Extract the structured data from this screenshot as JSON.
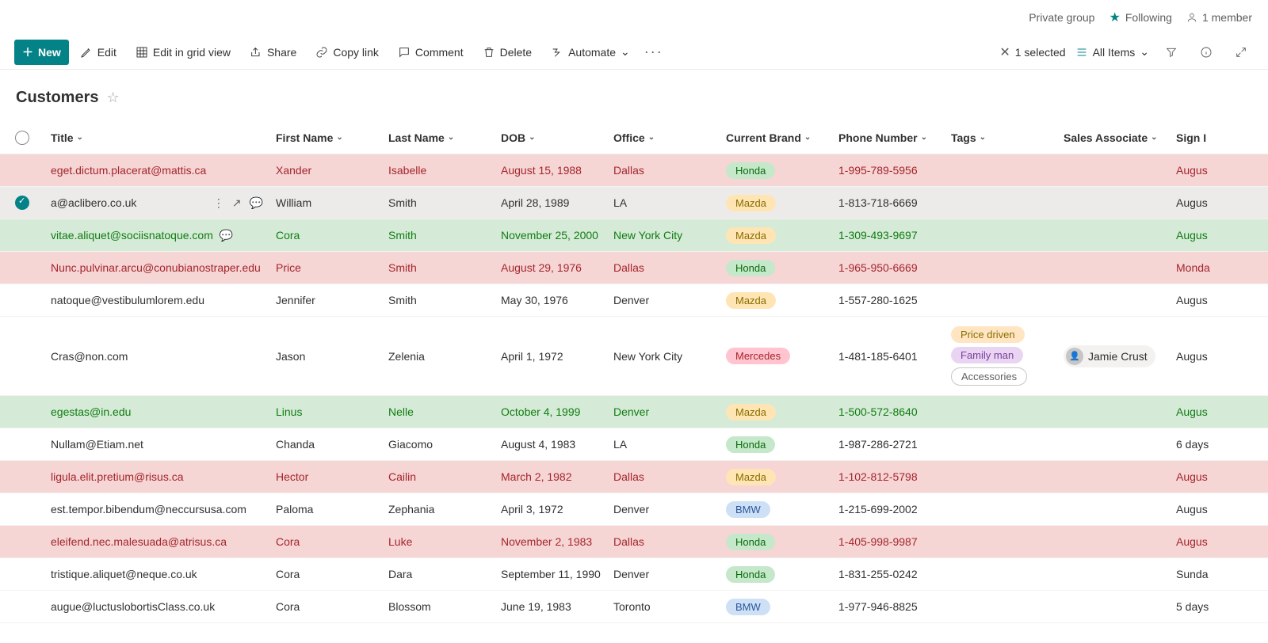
{
  "topbar": {
    "group_type": "Private group",
    "following": "Following",
    "members": "1 member"
  },
  "commands": {
    "new": "New",
    "edit": "Edit",
    "grid": "Edit in grid view",
    "share": "Share",
    "copy": "Copy link",
    "comment": "Comment",
    "delete": "Delete",
    "automate": "Automate",
    "selected": "1 selected",
    "view": "All Items"
  },
  "list": {
    "title": "Customers"
  },
  "columns": {
    "title": "Title",
    "first_name": "First Name",
    "last_name": "Last Name",
    "dob": "DOB",
    "office": "Office",
    "current_brand": "Current Brand",
    "phone": "Phone Number",
    "tags": "Tags",
    "sales_associate": "Sales Associate",
    "sign": "Sign I"
  },
  "rows": [
    {
      "style": "pink",
      "title": "eget.dictum.placerat@mattis.ca",
      "first": "Xander",
      "last": "Isabelle",
      "dob": "August 15, 1988",
      "office": "Dallas",
      "brand": "Honda",
      "phone": "1-995-789-5956",
      "sign": "Augus"
    },
    {
      "style": "selected",
      "title": "a@aclibero.co.uk",
      "first": "William",
      "last": "Smith",
      "dob": "April 28, 1989",
      "office": "LA",
      "brand": "Mazda",
      "phone": "1-813-718-6669",
      "sign": "Augus",
      "selected": true,
      "actions": true
    },
    {
      "style": "green",
      "title": "vitae.aliquet@sociisnatoque.com",
      "first": "Cora",
      "last": "Smith",
      "dob": "November 25, 2000",
      "office": "New York City",
      "brand": "Mazda",
      "phone": "1-309-493-9697",
      "sign": "Augus",
      "comment": true
    },
    {
      "style": "pink",
      "title": "Nunc.pulvinar.arcu@conubianostraper.edu",
      "first": "Price",
      "last": "Smith",
      "dob": "August 29, 1976",
      "office": "Dallas",
      "brand": "Honda",
      "phone": "1-965-950-6669",
      "sign": "Monda"
    },
    {
      "style": "",
      "title": "natoque@vestibulumlorem.edu",
      "first": "Jennifer",
      "last": "Smith",
      "dob": "May 30, 1976",
      "office": "Denver",
      "brand": "Mazda",
      "phone": "1-557-280-1625",
      "sign": "Augus"
    },
    {
      "style": "",
      "tall": true,
      "title": "Cras@non.com",
      "first": "Jason",
      "last": "Zelenia",
      "dob": "April 1, 1972",
      "office": "New York City",
      "brand": "Mercedes",
      "phone": "1-481-185-6401",
      "tags": [
        "Price driven",
        "Family man",
        "Accessories"
      ],
      "assoc": "Jamie Crust",
      "sign": "Augus"
    },
    {
      "style": "green",
      "title": "egestas@in.edu",
      "first": "Linus",
      "last": "Nelle",
      "dob": "October 4, 1999",
      "office": "Denver",
      "brand": "Mazda",
      "phone": "1-500-572-8640",
      "sign": "Augus"
    },
    {
      "style": "",
      "title": "Nullam@Etiam.net",
      "first": "Chanda",
      "last": "Giacomo",
      "dob": "August 4, 1983",
      "office": "LA",
      "brand": "Honda",
      "phone": "1-987-286-2721",
      "sign": "6 days"
    },
    {
      "style": "pink",
      "title": "ligula.elit.pretium@risus.ca",
      "first": "Hector",
      "last": "Cailin",
      "dob": "March 2, 1982",
      "office": "Dallas",
      "brand": "Mazda",
      "phone": "1-102-812-5798",
      "sign": "Augus"
    },
    {
      "style": "",
      "title": "est.tempor.bibendum@neccursusa.com",
      "first": "Paloma",
      "last": "Zephania",
      "dob": "April 3, 1972",
      "office": "Denver",
      "brand": "BMW",
      "phone": "1-215-699-2002",
      "sign": "Augus"
    },
    {
      "style": "pink",
      "title": "eleifend.nec.malesuada@atrisus.ca",
      "first": "Cora",
      "last": "Luke",
      "dob": "November 2, 1983",
      "office": "Dallas",
      "brand": "Honda",
      "phone": "1-405-998-9987",
      "sign": "Augus"
    },
    {
      "style": "",
      "title": "tristique.aliquet@neque.co.uk",
      "first": "Cora",
      "last": "Dara",
      "dob": "September 11, 1990",
      "office": "Denver",
      "brand": "Honda",
      "phone": "1-831-255-0242",
      "sign": "Sunda"
    },
    {
      "style": "",
      "title": "augue@luctuslobortisClass.co.uk",
      "first": "Cora",
      "last": "Blossom",
      "dob": "June 19, 1983",
      "office": "Toronto",
      "brand": "BMW",
      "phone": "1-977-946-8825",
      "sign": "5 days"
    }
  ]
}
